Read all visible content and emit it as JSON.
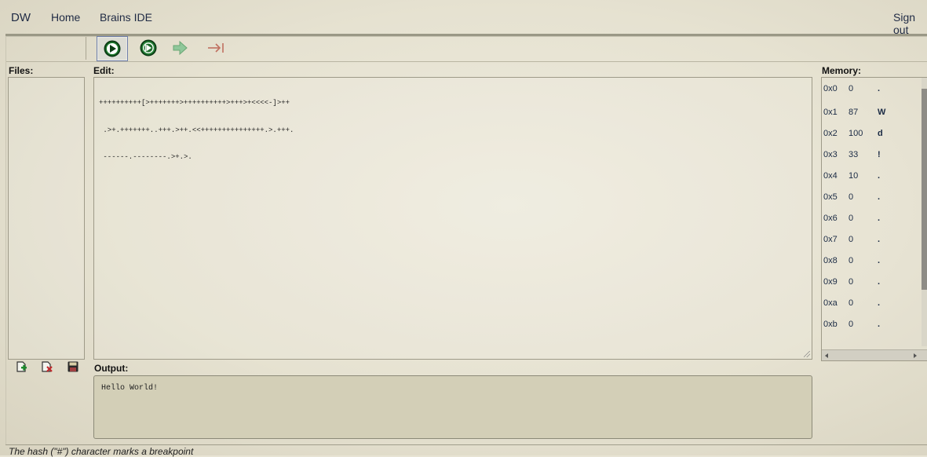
{
  "nav": {
    "brand": "DW",
    "home": "Home",
    "app": "Brains IDE",
    "signout": "Sign out"
  },
  "toolbar": {
    "run": "run-icon",
    "run_debug": "run-debug-icon",
    "step": "step-icon",
    "step_to_end": "step-to-end-icon"
  },
  "labels": {
    "files": "Files:",
    "edit": "Edit:",
    "memory": "Memory:",
    "output": "Output:"
  },
  "editor": {
    "lines": [
      "++++++++++[>+++++++>++++++++++>+++>+<<<<-]>++",
      " .>+.+++++++..+++.>++.<<+++++++++++++++.>.+++.",
      " ------.--------.>+.>."
    ]
  },
  "output": {
    "text": "Hello World!"
  },
  "memory": {
    "rows": [
      {
        "addr": "0x0",
        "val": "0",
        "chr": "."
      },
      {
        "addr": "0x1",
        "val": "87",
        "chr": "W"
      },
      {
        "addr": "0x2",
        "val": "100",
        "chr": "d"
      },
      {
        "addr": "0x3",
        "val": "33",
        "chr": "!"
      },
      {
        "addr": "0x4",
        "val": "10",
        "chr": "."
      },
      {
        "addr": "0x5",
        "val": "0",
        "chr": "."
      },
      {
        "addr": "0x6",
        "val": "0",
        "chr": "."
      },
      {
        "addr": "0x7",
        "val": "0",
        "chr": "."
      },
      {
        "addr": "0x8",
        "val": "0",
        "chr": "."
      },
      {
        "addr": "0x9",
        "val": "0",
        "chr": "."
      },
      {
        "addr": "0xa",
        "val": "0",
        "chr": "."
      },
      {
        "addr": "0xb",
        "val": "0",
        "chr": "."
      }
    ]
  },
  "file_actions": {
    "new": "new-file-icon",
    "delete": "delete-file-icon",
    "save": "save-file-icon"
  },
  "footer": {
    "hint": "The hash (\"#\") character marks a breakpoint"
  }
}
